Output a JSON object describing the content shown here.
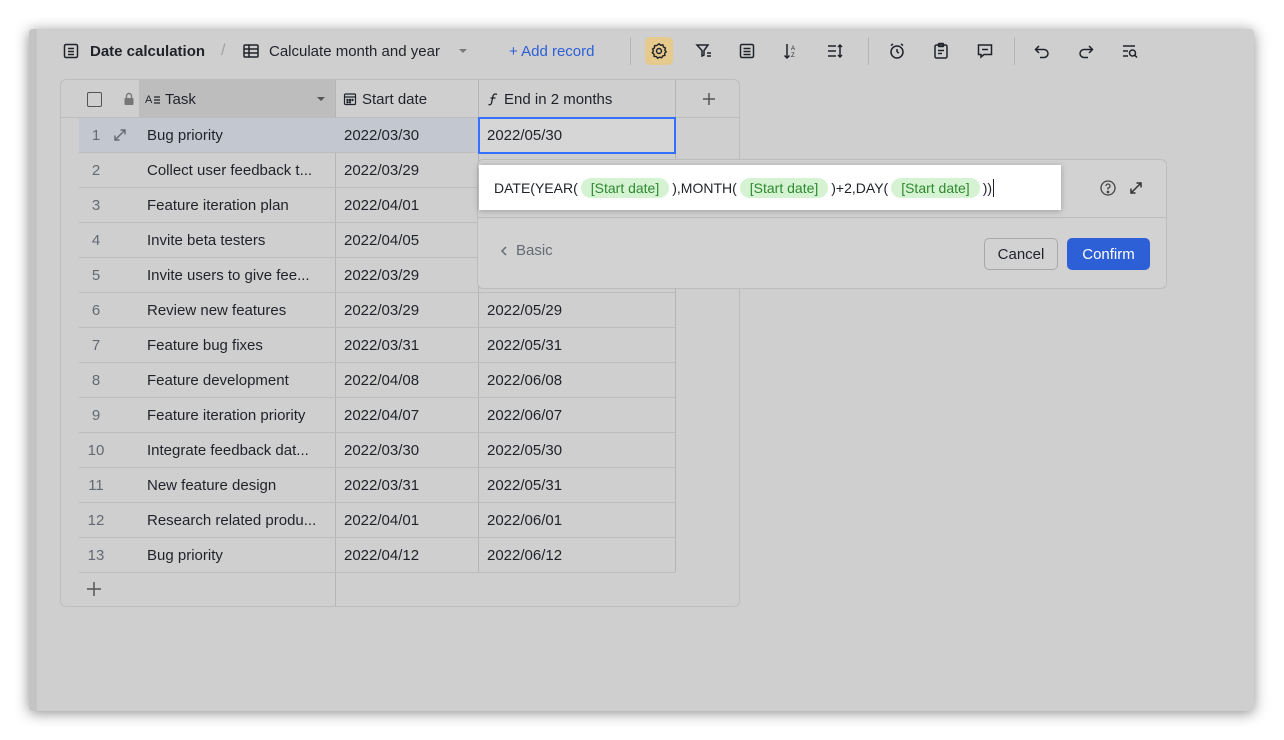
{
  "toolbar": {
    "base_title": "Date calculation",
    "separator": "/",
    "view_name": "Calculate month and year",
    "add_record": "+ Add record"
  },
  "grid": {
    "columns": [
      {
        "name": "Task",
        "icon": "text-field-icon"
      },
      {
        "name": "Start date",
        "icon": "calendar-field-icon"
      },
      {
        "name": "End in 2 months",
        "icon": "formula-field-icon"
      }
    ],
    "rows": [
      {
        "num": "1",
        "task": "Bug priority",
        "start": "2022/03/30",
        "end": "2022/05/30"
      },
      {
        "num": "2",
        "task": "Collect user feedback t...",
        "start": "2022/03/29",
        "end": ""
      },
      {
        "num": "3",
        "task": "Feature iteration plan",
        "start": "2022/04/01",
        "end": ""
      },
      {
        "num": "4",
        "task": "Invite beta testers",
        "start": "2022/04/05",
        "end": ""
      },
      {
        "num": "5",
        "task": "Invite users to give fee...",
        "start": "2022/03/29",
        "end": ""
      },
      {
        "num": "6",
        "task": "Review new features",
        "start": "2022/03/29",
        "end": "2022/05/29"
      },
      {
        "num": "7",
        "task": "Feature bug fixes",
        "start": "2022/03/31",
        "end": "2022/05/31"
      },
      {
        "num": "8",
        "task": "Feature development",
        "start": "2022/04/08",
        "end": "2022/06/08"
      },
      {
        "num": "9",
        "task": "Feature iteration priority",
        "start": "2022/04/07",
        "end": "2022/06/07"
      },
      {
        "num": "10",
        "task": "Integrate feedback dat...",
        "start": "2022/03/30",
        "end": "2022/05/30"
      },
      {
        "num": "11",
        "task": "New feature design",
        "start": "2022/03/31",
        "end": "2022/05/31"
      },
      {
        "num": "12",
        "task": "Research related produ...",
        "start": "2022/04/01",
        "end": "2022/06/01"
      },
      {
        "num": "13",
        "task": "Bug priority",
        "start": "2022/04/12",
        "end": "2022/06/12"
      }
    ]
  },
  "formula": {
    "part1": "DATE(YEAR(",
    "ref1": "[Start date]",
    "part2": "),MONTH(",
    "ref2": "[Start date]",
    "part3": ")+2,DAY(",
    "ref3": "[Start date]",
    "part4": "))"
  },
  "panel": {
    "basic_label": "Basic",
    "cancel": "Cancel",
    "confirm": "Confirm"
  },
  "colors": {
    "accent": "#2d5fd6",
    "tag_bg": "#d5f3d3",
    "tag_text": "#2e8a2e",
    "active_settings_bg": "#e6c98d"
  }
}
